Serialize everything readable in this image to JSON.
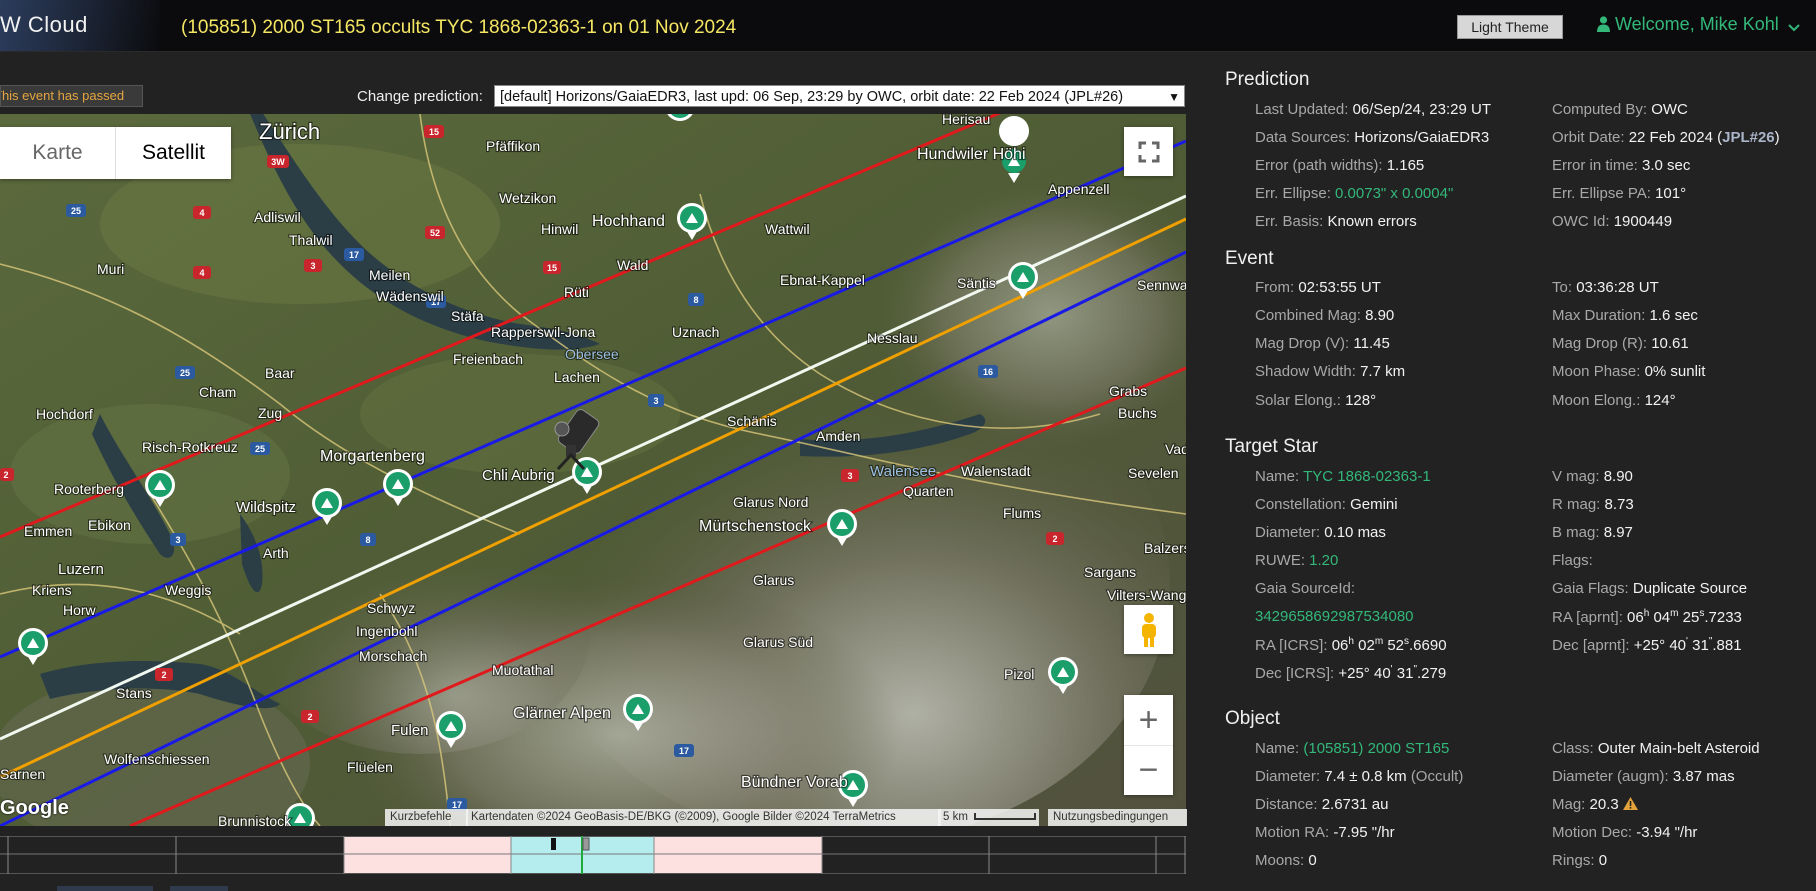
{
  "header": {
    "brand": "W Cloud",
    "title": "(105851) 2000 ST165 occults TYC 1868-02363-1 on 01 Nov 2024",
    "theme_button": "Light Theme",
    "welcome": "Welcome, Mike Kohl"
  },
  "toolbar": {
    "passed_notice": "This event has passed",
    "change_prediction_label": "Change prediction:",
    "prediction_selected": "[default] Horizons/GaiaEDR3, last upd: 06 Sep, 23:29 by OWC, orbit date: 22 Feb 2024 (JPL#26)"
  },
  "map": {
    "toggle": [
      "Karte",
      "Satellit"
    ],
    "places": [
      "Zürich",
      "Pfäffikon",
      "Herisau",
      "Hundwiler Höhi",
      "Appenzell",
      "Adliswil",
      "Thalwil",
      "Wetzikon",
      "Hinwil",
      "Hochhand",
      "Wattwil",
      "Muri",
      "Meilen",
      "Wald",
      "Ebnat-Kappel",
      "Säntis",
      "Sennwald",
      "Wädenswil",
      "Stäfa",
      "Rüti",
      "Rapperswil-Jona",
      "Uznach",
      "Nesslau",
      "Obersee",
      "Freienbach",
      "Lachen",
      "Baar",
      "Cham",
      "Hochdorf",
      "Zug",
      "Risch-Rotkreuz",
      "Morgartenberg",
      "Schänis",
      "Amden",
      "Buchs",
      "Grabs",
      "Chli Aubrig",
      "Walensee",
      "Walenstadt",
      "Vad",
      "Sevelen",
      "Rooterberg",
      "Emmen",
      "Ebikon",
      "Wildspitz",
      "Arth",
      "Glarus Nord",
      "Quarten",
      "Flums",
      "Mürtschenstock",
      "Balzers",
      "Luzern",
      "Kriens",
      "Horw",
      "Weggis",
      "Schwyz",
      "Glarus",
      "Sargans",
      "Vilters-Wangs",
      "Ingenbohl",
      "Morschach",
      "Glarus Süd",
      "Stans",
      "Muotathal",
      "Pizol",
      "Glärner Alpen",
      "Fulen",
      "Wolfenschiessen",
      "Flüelen",
      "Sarnen",
      "Bündner Vorab",
      "Brunnistock"
    ],
    "road_numbers": [
      "15",
      "3W",
      "25",
      "4",
      "52",
      "3",
      "17",
      "4",
      "3",
      "15",
      "17",
      "8",
      "25",
      "3",
      "16",
      "25",
      "2",
      "3",
      "2",
      "8",
      "3",
      "2",
      "2",
      "17",
      "17"
    ],
    "attribution": [
      "Kurzbefehle",
      "Kartendaten ©2024 GeoBasis-DE/BKG (©2009), Google Bilder ©2024 TerraMetrics",
      "5 km",
      "Nutzungsbedingungen"
    ],
    "logo": "Google",
    "fullscreen_icon": "fullscreen-icon",
    "pegman_icon": "pegman-icon",
    "zoom_in": "+",
    "zoom_out": "−"
  },
  "prediction": {
    "title": "Prediction",
    "left": [
      {
        "label": "Last Updated:",
        "value": "06/Sep/24, 23:29 UT"
      },
      {
        "label": "Data Sources:",
        "value": "Horizons/GaiaEDR3"
      },
      {
        "label": "Error (path widths):",
        "value": "1.165"
      },
      {
        "label": "Err. Ellipse:",
        "value": "0.0073\" x 0.0004\""
      },
      {
        "label": "Err. Basis:",
        "value": "Known errors"
      }
    ],
    "right": [
      {
        "label": "Computed By:",
        "value": "OWC"
      },
      {
        "label": "Orbit Date:",
        "value": "22 Feb 2024 (",
        "extra": "JPL#26",
        "tail": ")"
      },
      {
        "label": "Error in time:",
        "value": "3.0 sec"
      },
      {
        "label": "Err. Ellipse PA:",
        "value": "101°"
      },
      {
        "label": "OWC Id:",
        "value": "1900449"
      }
    ]
  },
  "event": {
    "title": "Event",
    "left": [
      {
        "label": "From:",
        "value": "02:53:55 UT"
      },
      {
        "label": "Combined Mag:",
        "value": "8.90"
      },
      {
        "label": "Mag Drop (V):",
        "value": "11.45"
      },
      {
        "label": "Shadow Width:",
        "value": "7.7 km"
      },
      {
        "label": "Solar Elong.:",
        "value": "128°"
      }
    ],
    "right": [
      {
        "label": "To:",
        "value": "03:36:28 UT"
      },
      {
        "label": "Max Duration:",
        "value": "1.6 sec"
      },
      {
        "label": "Mag Drop (R):",
        "value": "10.61"
      },
      {
        "label": "Moon Phase:",
        "value": "0% sunlit"
      },
      {
        "label": "Moon Elong.:",
        "value": "124°"
      }
    ]
  },
  "target_star": {
    "title": "Target Star",
    "name_label": "Name:",
    "name": "TYC 1868-02363-1",
    "constellation_label": "Constellation:",
    "constellation": "Gemini",
    "diameter_label": "Diameter:",
    "diameter": "0.10 mas",
    "ruwe_label": "RUWE:",
    "ruwe": "1.20",
    "gaia_label": "Gaia SourceId:",
    "gaia_id": "3429658692987534080",
    "ra_icrs_label": "RA [ICRS]:",
    "ra_icrs": {
      "h": "06",
      "m": "02",
      "s": "52",
      "frac": ".6690"
    },
    "dec_icrs_label": "Dec [ICRS]:",
    "dec_icrs": {
      "d": "+25°",
      "m": "40",
      "s": "31",
      "frac": ".279"
    },
    "vmag_label": "V mag:",
    "vmag": "8.90",
    "rmag_label": "R mag:",
    "rmag": "8.73",
    "bmag_label": "B mag:",
    "bmag": "8.97",
    "flags_label": "Flags:",
    "gaia_flags_label": "Gaia Flags:",
    "gaia_flags": "Duplicate Source",
    "ra_aprnt_label": "RA [aprnt]:",
    "ra_aprnt": {
      "h": "06",
      "m": "04",
      "s": "25",
      "frac": ".7233"
    },
    "dec_aprnt_label": "Dec [aprnt]:",
    "dec_aprnt": {
      "d": "+25°",
      "m": "40",
      "s": "31",
      "frac": ".881"
    }
  },
  "object": {
    "title": "Object",
    "name_label": "Name:",
    "name": "(105851) 2000 ST165",
    "diameter_label": "Diameter:",
    "diameter": "7.4 ± 0.8 km",
    "diameter_src": "(Occult)",
    "distance_label": "Distance:",
    "distance": "2.6731 au",
    "motion_ra_label": "Motion RA:",
    "motion_ra": "-7.95 \"/hr",
    "moons_label": "Moons:",
    "moons": "0",
    "class_label": "Class:",
    "class": "Outer Main-belt Asteroid",
    "diam_augm_label": "Diameter (augm):",
    "diam_augm": "3.87 mas",
    "mag_label": "Mag:",
    "mag": "20.3",
    "motion_dec_label": "Motion Dec:",
    "motion_dec": "-3.94 \"/hr",
    "rings_label": "Rings:",
    "rings": "0"
  },
  "colors": {
    "accent_green": "#33b87a",
    "title_yellow": "#f5e663",
    "path_red": "#e0191c",
    "path_blue": "#1a1ae6",
    "path_center": "#f0f8f0",
    "path_orange": "#f0a000"
  }
}
